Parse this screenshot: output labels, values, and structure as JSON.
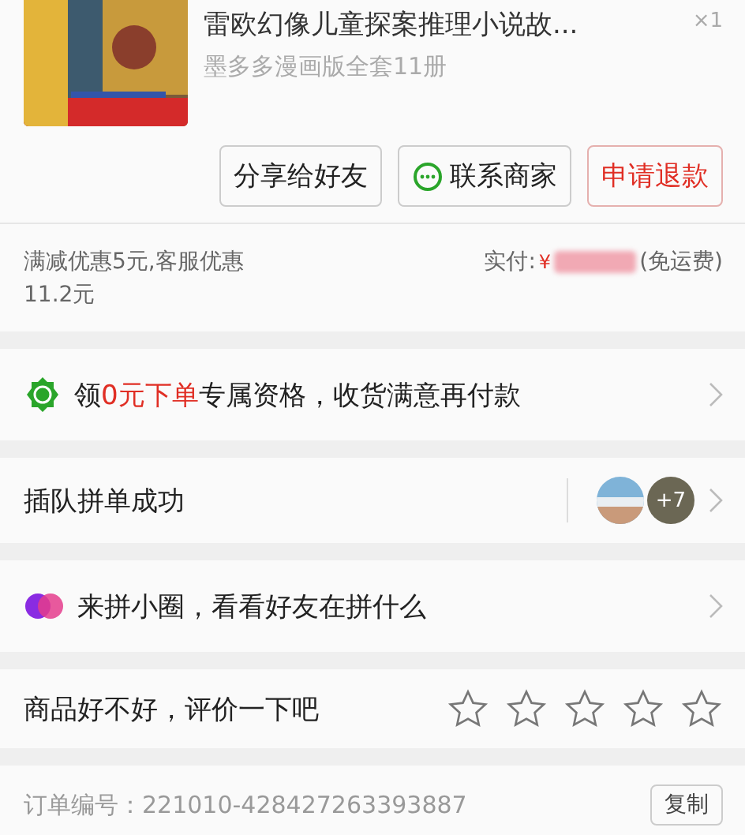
{
  "product": {
    "title": "雷欧幻像儿童探案推理小说故...",
    "subtitle": "墨多多漫画版全套11册",
    "quantity": "×1"
  },
  "actions": [
    {
      "label": "分享给好友",
      "kind": "plain"
    },
    {
      "label": "联系商家",
      "kind": "chat"
    },
    {
      "label": "申请退款",
      "kind": "danger"
    }
  ],
  "payment": {
    "discount": "满减优惠5元,客服优惠11.2元",
    "paid_label": "实付:",
    "currency": "¥",
    "amount_redacted": true,
    "shipping": "(免运费)"
  },
  "rows": [
    {
      "kind": "promo",
      "text": "领**0元下单**专属资格，收货满意再付款"
    },
    {
      "kind": "group",
      "text": "插队拼单成功",
      "extra_count": "+7"
    },
    {
      "kind": "circle",
      "text": "来拼小圈，看看好友在拼什么"
    },
    {
      "kind": "rating",
      "text": "商品好不好，评价一下吧",
      "stars": 0
    }
  ],
  "order": {
    "label": "订单编号：",
    "number": "221010-428427263393887",
    "copy_button": "复制"
  }
}
